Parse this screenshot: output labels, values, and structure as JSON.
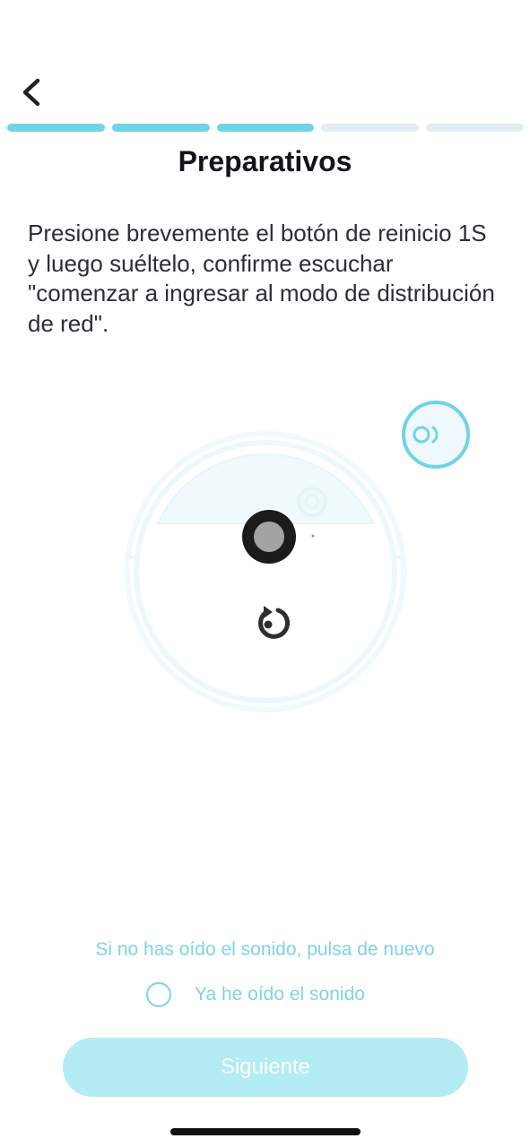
{
  "nav": {
    "back_icon": "chevron-left-icon"
  },
  "progress": {
    "total_steps": 5,
    "completed_steps": 3,
    "active_color": "#6fd4e6",
    "inactive_color": "#e4edf6"
  },
  "header": {
    "title": "Preparativos"
  },
  "instruction": {
    "text": "Presione brevemente el botón de reinicio 1S y luego suéltelo, confirme escuchar \"comenzar a ingresar al modo de distribución de red\"."
  },
  "illustration": {
    "robot_icon": "robot-vacuum-icon",
    "button_icon": "reset-button-icon",
    "reset_icon": "rotate-arrow-icon",
    "sound_icon": "sound-wave-icon"
  },
  "footer": {
    "hint_link": "Si no has oído el sonido, pulsa de nuevo",
    "confirm_label": "Ya he oído el sonido",
    "confirm_checked": false,
    "next_button": "Siguiente",
    "accent_color": "#7fd3e4",
    "button_color": "#b3ecf4"
  }
}
